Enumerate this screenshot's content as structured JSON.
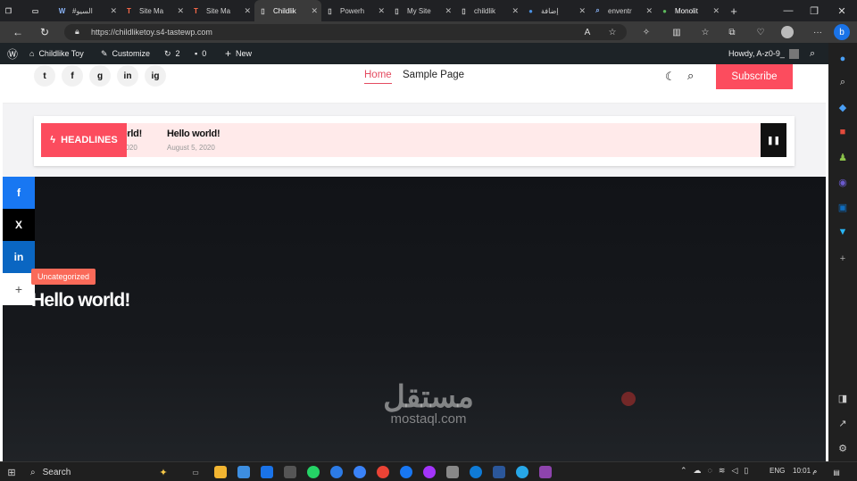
{
  "browser": {
    "tabs": [
      {
        "label": "",
        "favicon": "workspaces-icon",
        "color": "#cfcfcf"
      },
      {
        "label": "",
        "favicon": "tab-actions-icon",
        "color": "#cfcfcf"
      },
      {
        "label": "#السيو",
        "favicon": "wordpress-icon",
        "color": "#8ab4f8"
      },
      {
        "label": "Site Ma",
        "favicon": "tastewp-icon",
        "color": "#ff6b4a"
      },
      {
        "label": "Site Ma",
        "favicon": "tastewp-icon",
        "color": "#ff6b4a"
      },
      {
        "label": "Childlik",
        "favicon": "page-icon",
        "color": "#cfcfcf"
      },
      {
        "label": "Powerh",
        "favicon": "page-icon",
        "color": "#cfcfcf"
      },
      {
        "label": "My Site",
        "favicon": "page-icon",
        "color": "#cfcfcf"
      },
      {
        "label": "childlik",
        "favicon": "page-icon",
        "color": "#cfcfcf"
      },
      {
        "label": "إضافة",
        "favicon": "circle-icon",
        "color": "#4a90e2"
      },
      {
        "label": "enventr",
        "favicon": "search-icon",
        "color": "#8ab4f8"
      },
      {
        "label": "Monolit",
        "favicon": "leaf-icon",
        "color": "#5cb85c"
      }
    ],
    "new_tab": "+",
    "url": "https://childliketoy.s4-tastewp.com"
  },
  "wp_admin": {
    "site_name": "Childlike Toy",
    "customize": "Customize",
    "updates": "2",
    "comments": "0",
    "new": "New",
    "howdy": "Howdy, A-z0-9_"
  },
  "site": {
    "social_icons": [
      "twitter-icon",
      "facebook-icon",
      "github-icon",
      "linkedin-icon",
      "instagram-icon"
    ],
    "social_glyphs": [
      "t",
      "f",
      "g",
      "in",
      "ig"
    ],
    "menu": [
      "Home",
      "Sample Page"
    ],
    "subscribe": "Subscribe",
    "headlines_label": "HEADLINES",
    "ticker": [
      {
        "title": "orld!",
        "date": "2020"
      },
      {
        "title": "Hello world!",
        "date": "August 5, 2020"
      }
    ],
    "share": [
      "f",
      "X",
      "in",
      "+"
    ],
    "category": "Uncategorized",
    "hero_title": "Hello world!"
  },
  "watermark": {
    "arabic": "مستقل",
    "latin": "mostaql.com"
  },
  "taskbar": {
    "search": "Search",
    "lang": "ENG",
    "time": "10:01 م"
  },
  "colors": {
    "accent": "#fc4c5e",
    "admin_bar": "#1d2327",
    "category": "#fa6a59"
  }
}
